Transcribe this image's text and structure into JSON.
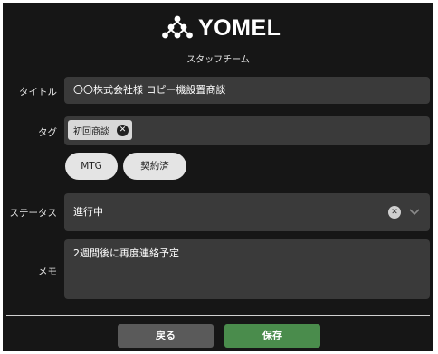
{
  "header": {
    "logo_text": "YOMEL",
    "subtitle": "スタッフチーム"
  },
  "form": {
    "title_label": "タイトル",
    "title_value": "〇〇株式会社様 コピー機設置商談",
    "tag_label": "タグ",
    "tags": [
      "初回商談"
    ],
    "tag_options": [
      "MTG",
      "契約済"
    ],
    "status_label": "ステータス",
    "status_value": "進行中",
    "memo_label": "メモ",
    "memo_value": "2週間後に再度連絡予定"
  },
  "buttons": {
    "back_label": "戻る",
    "save_label": "保存"
  },
  "colors": {
    "panel_bg": "#161616",
    "field_bg": "#3a3a3a",
    "save_accent": "#4a8c4c",
    "back_bg": "#5a5a5a"
  },
  "icons": {
    "logo": "people-group-icon",
    "tag_remove": "close-circle-icon",
    "status_clear": "close-circle-icon",
    "status_dropdown": "chevron-down-icon"
  }
}
